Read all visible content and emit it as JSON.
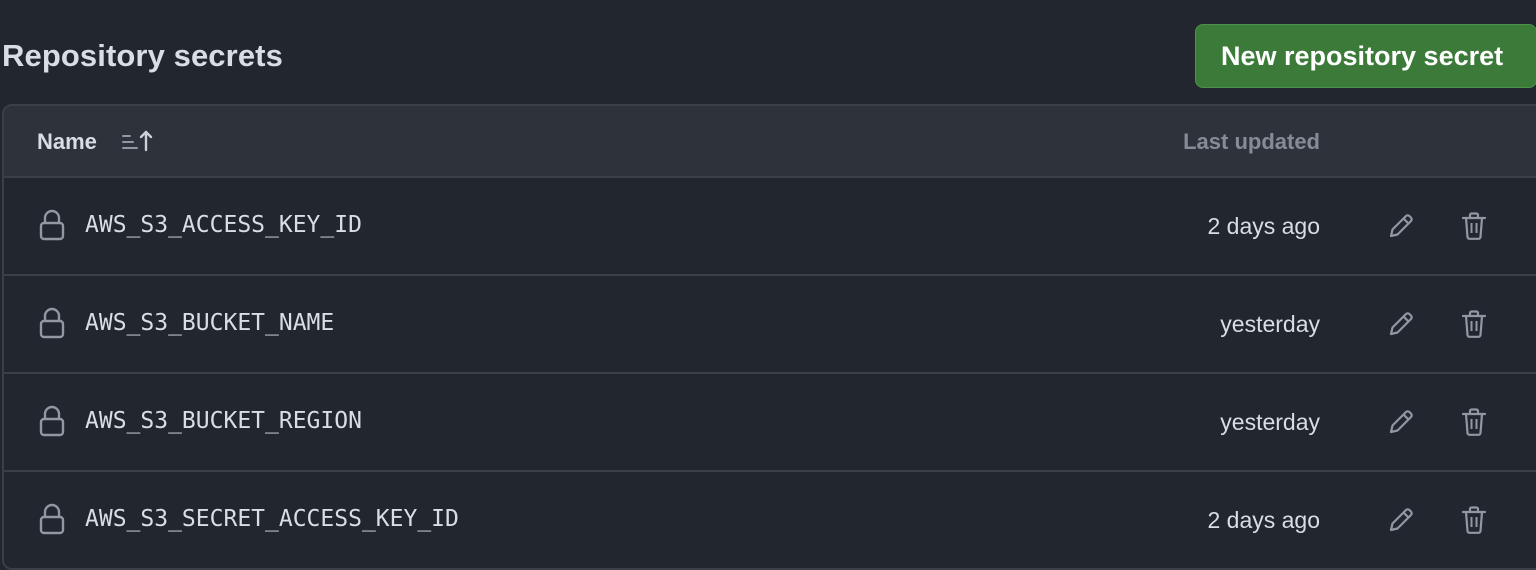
{
  "section": {
    "title": "Repository secrets",
    "new_button_label": "New repository secret"
  },
  "table": {
    "headers": {
      "name": "Name",
      "last_updated": "Last updated"
    },
    "rows": [
      {
        "name": "AWS_S3_ACCESS_KEY_ID",
        "updated": "2 days ago"
      },
      {
        "name": "AWS_S3_BUCKET_NAME",
        "updated": "yesterday"
      },
      {
        "name": "AWS_S3_BUCKET_REGION",
        "updated": "yesterday"
      },
      {
        "name": "AWS_S3_SECRET_ACCESS_KEY_ID",
        "updated": "2 days ago"
      }
    ]
  },
  "icons": {
    "row_icon": "lock-icon",
    "sort": "sort-ascending-icon",
    "edit": "pencil-icon",
    "delete": "trash-icon"
  },
  "colors": {
    "background": "#22262e",
    "primary_button": "#3b7a39",
    "border": "#3b4048",
    "header_background": "#2e323a",
    "muted_text": "#858c96",
    "text": "#d9dee4",
    "icon": "#9198a1"
  }
}
